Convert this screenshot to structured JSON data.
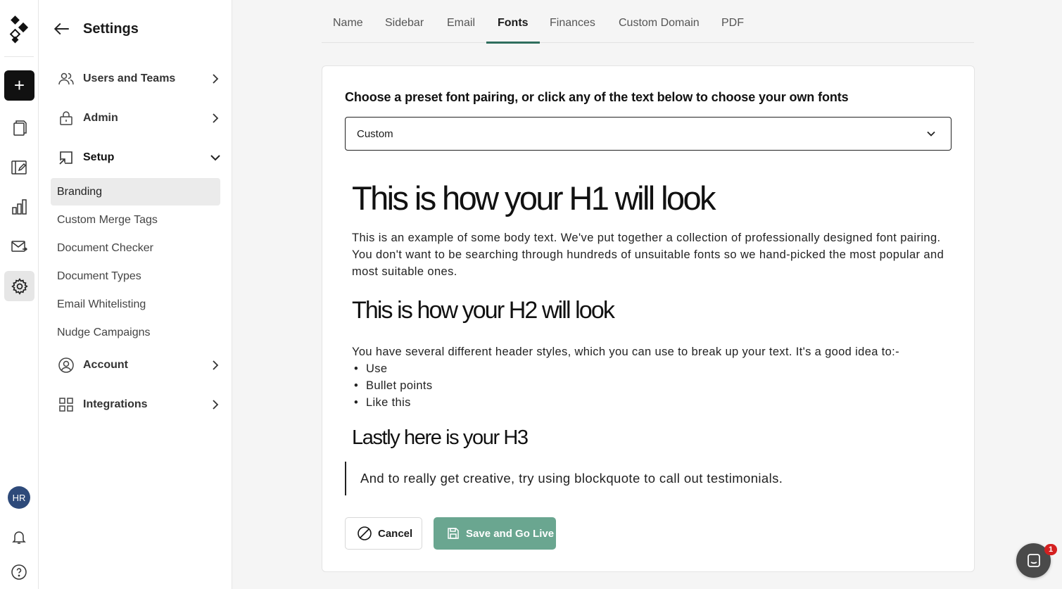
{
  "sidebar": {
    "title": "Settings",
    "groups": {
      "users_teams": "Users and Teams",
      "admin": "Admin",
      "setup": "Setup",
      "account": "Account",
      "integrations": "Integrations"
    },
    "setup_items": [
      "Branding",
      "Custom Merge Tags",
      "Document Checker",
      "Document Types",
      "Email Whitelisting",
      "Nudge Campaigns"
    ],
    "active_item": "Branding"
  },
  "rail": {
    "avatar_initials": "HR",
    "new_label": "+"
  },
  "tabs": [
    "Name",
    "Sidebar",
    "Email",
    "Fonts",
    "Finances",
    "Custom Domain",
    "PDF"
  ],
  "active_tab": "Fonts",
  "fonts": {
    "prompt": "Choose a preset font pairing, or click any of the text below to choose your own fonts",
    "selected_pairing": "Custom",
    "h1": "This is how your H1 will look",
    "body_text": "This is an example of some body text. We've put together a collection of professionally designed font pairing. You don't want to be searching through hundreds of unsuitable fonts so we hand-picked the most popular and most suitable ones.",
    "h2": "This is how your H2 will look",
    "body_text_2": "You have several different header styles, which you can use to break up your text. It's a good idea to:-",
    "bullets": [
      "Use",
      "Bullet points",
      "Like this"
    ],
    "h3": "Lastly here is your H3",
    "blockquote": "And to really get creative, try using blockquote to call out testimonials."
  },
  "actions": {
    "cancel_label": "Cancel",
    "save_label": "Save and Go Live"
  },
  "chat": {
    "badge_count": "1"
  },
  "colors": {
    "accent": "#2f6e5e",
    "save_button": "#6aa690",
    "badge": "#d42020"
  }
}
